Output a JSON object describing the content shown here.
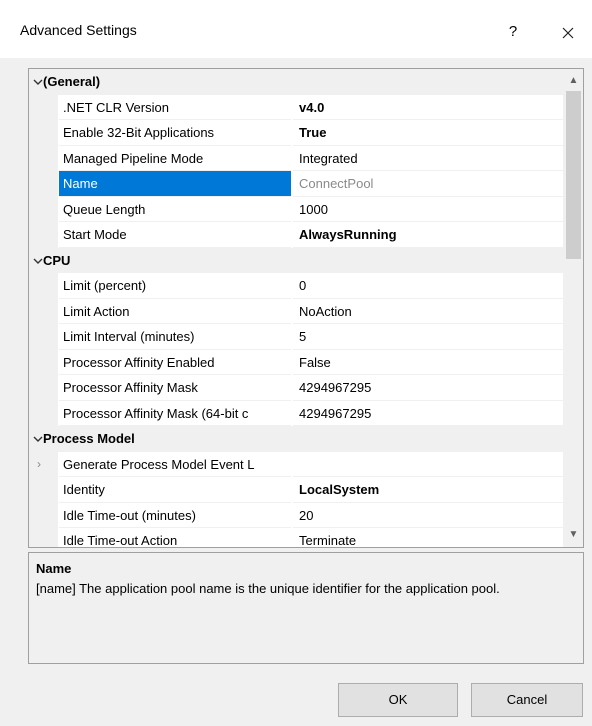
{
  "dialog": {
    "title": "Advanced Settings",
    "help_label": "?",
    "close_icon": "close-icon"
  },
  "grid": {
    "rows": [
      {
        "kind": "category",
        "label": "(General)",
        "expanded": true
      },
      {
        "kind": "property",
        "name": ".NET CLR Version",
        "value": "v4.0",
        "style": "bold"
      },
      {
        "kind": "property",
        "name": "Enable 32-Bit Applications",
        "value": "True",
        "style": "bold"
      },
      {
        "kind": "property",
        "name": "Managed Pipeline Mode",
        "value": "Integrated",
        "style": "normal"
      },
      {
        "kind": "property",
        "name": "Name",
        "value": "ConnectPool",
        "style": "grey",
        "selected": true
      },
      {
        "kind": "property",
        "name": "Queue Length",
        "value": "1000",
        "style": "normal"
      },
      {
        "kind": "property",
        "name": "Start Mode",
        "value": "AlwaysRunning",
        "style": "bold"
      },
      {
        "kind": "category",
        "label": "CPU",
        "expanded": true
      },
      {
        "kind": "property",
        "name": "Limit (percent)",
        "value": "0",
        "style": "normal"
      },
      {
        "kind": "property",
        "name": "Limit Action",
        "value": "NoAction",
        "style": "normal"
      },
      {
        "kind": "property",
        "name": "Limit Interval (minutes)",
        "value": "5",
        "style": "normal"
      },
      {
        "kind": "property",
        "name": "Processor Affinity Enabled",
        "value": "False",
        "style": "normal"
      },
      {
        "kind": "property",
        "name": "Processor Affinity Mask",
        "value": "4294967295",
        "style": "normal"
      },
      {
        "kind": "property",
        "name": "Processor Affinity Mask (64-bit c",
        "value": "4294967295",
        "style": "normal"
      },
      {
        "kind": "category",
        "label": "Process Model",
        "expanded": true
      },
      {
        "kind": "property",
        "name": "Generate Process Model Event L",
        "value": "",
        "style": "normal",
        "expandable": true
      },
      {
        "kind": "property",
        "name": "Identity",
        "value": "LocalSystem",
        "style": "bold"
      },
      {
        "kind": "property",
        "name": "Idle Time-out (minutes)",
        "value": "20",
        "style": "normal"
      },
      {
        "kind": "property",
        "name": "Idle Time-out Action",
        "value": "Terminate",
        "style": "normal"
      }
    ]
  },
  "description": {
    "title": "Name",
    "text": "[name] The application pool name is the unique identifier for the application pool."
  },
  "buttons": {
    "ok_label": "OK",
    "cancel_label": "Cancel"
  },
  "colors": {
    "selection": "#0078d7",
    "category_bg": "#f0f0f0"
  }
}
